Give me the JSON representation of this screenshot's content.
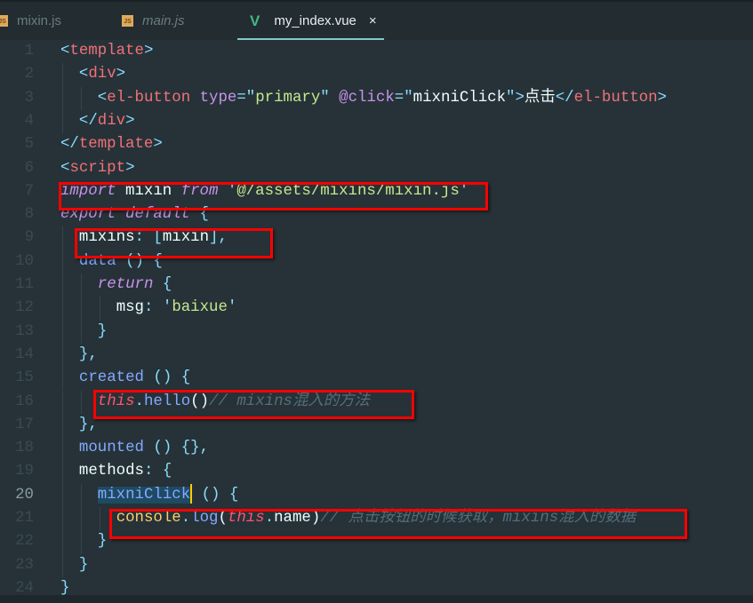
{
  "tabs": [
    {
      "label": "mixin.js",
      "icon": "js-file-icon",
      "active": false
    },
    {
      "label": "main.js",
      "icon": "js-file-icon",
      "active": false
    },
    {
      "label": "my_index.vue",
      "icon": "vue-file-icon",
      "active": true
    }
  ],
  "tab_close": "×",
  "js_icon_text": "JS",
  "vue_icon_text": "V",
  "current_line": 20,
  "lines": [
    {
      "n": "1",
      "indent": 0,
      "t": [
        [
          "<",
          "punct"
        ],
        [
          "template",
          "tag"
        ],
        [
          ">",
          "punct"
        ]
      ]
    },
    {
      "n": "2",
      "indent": 1,
      "t": [
        [
          "<",
          "punct"
        ],
        [
          "div",
          "tag"
        ],
        [
          ">",
          "punct"
        ]
      ]
    },
    {
      "n": "3",
      "indent": 2,
      "t": [
        [
          "<",
          "punct"
        ],
        [
          "el-button",
          "tag"
        ],
        [
          " ",
          "plain"
        ],
        [
          "type",
          "attr"
        ],
        [
          "=\"",
          "punct"
        ],
        [
          "primary",
          "str"
        ],
        [
          "\"",
          "punct"
        ],
        [
          " ",
          "plain"
        ],
        [
          "@click",
          "attr"
        ],
        [
          "=\"",
          "punct"
        ],
        [
          "mixniClick",
          "plain"
        ],
        [
          "\"",
          "punct"
        ],
        [
          ">",
          "punct"
        ],
        [
          "点击",
          "plain"
        ],
        [
          "</",
          "punct"
        ],
        [
          "el-button",
          "tag"
        ],
        [
          ">",
          "punct"
        ]
      ]
    },
    {
      "n": "4",
      "indent": 1,
      "t": [
        [
          "</",
          "punct"
        ],
        [
          "div",
          "tag"
        ],
        [
          ">",
          "punct"
        ]
      ]
    },
    {
      "n": "5",
      "indent": 0,
      "t": [
        [
          "</",
          "punct"
        ],
        [
          "template",
          "tag"
        ],
        [
          ">",
          "punct"
        ]
      ]
    },
    {
      "n": "6",
      "indent": 0,
      "t": [
        [
          "<",
          "punct"
        ],
        [
          "script",
          "tag"
        ],
        [
          ">",
          "punct"
        ]
      ]
    },
    {
      "n": "7",
      "indent": 0,
      "t": [
        [
          "import",
          "kw"
        ],
        [
          " mixin ",
          "plain"
        ],
        [
          "from",
          "kw"
        ],
        [
          " ",
          "plain"
        ],
        [
          "'",
          "punct"
        ],
        [
          "@/assets/mixins/mixin.js",
          "str"
        ],
        [
          "'",
          "punct"
        ]
      ]
    },
    {
      "n": "8",
      "indent": 0,
      "t": [
        [
          "export",
          "kw"
        ],
        [
          " ",
          "plain"
        ],
        [
          "default",
          "kw"
        ],
        [
          " {",
          "punct"
        ]
      ]
    },
    {
      "n": "9",
      "indent": 1,
      "t": [
        [
          "mixins",
          "plain"
        ],
        [
          ": [",
          "punct"
        ],
        [
          "mixin",
          "plain"
        ],
        [
          "],",
          "punct"
        ]
      ]
    },
    {
      "n": "10",
      "indent": 1,
      "t": [
        [
          "data",
          "fn"
        ],
        [
          " () {",
          "punct"
        ]
      ]
    },
    {
      "n": "11",
      "indent": 2,
      "t": [
        [
          "return",
          "kw"
        ],
        [
          " {",
          "punct"
        ]
      ]
    },
    {
      "n": "12",
      "indent": 3,
      "t": [
        [
          "msg",
          "plain"
        ],
        [
          ": ",
          "punct"
        ],
        [
          "'",
          "punct"
        ],
        [
          "baixue",
          "str"
        ],
        [
          "'",
          "punct"
        ]
      ]
    },
    {
      "n": "13",
      "indent": 2,
      "t": [
        [
          "}",
          "punct"
        ]
      ]
    },
    {
      "n": "14",
      "indent": 1,
      "t": [
        [
          "},",
          "punct"
        ]
      ]
    },
    {
      "n": "15",
      "indent": 1,
      "t": [
        [
          "created",
          "fn"
        ],
        [
          " () {",
          "punct"
        ]
      ]
    },
    {
      "n": "16",
      "indent": 2,
      "t": [
        [
          "this",
          "this"
        ],
        [
          ".",
          "punct"
        ],
        [
          "hello",
          "fn"
        ],
        [
          "()",
          "plain"
        ],
        [
          "// mixins混入的方法",
          "cmt"
        ]
      ]
    },
    {
      "n": "17",
      "indent": 1,
      "t": [
        [
          "},",
          "punct"
        ]
      ]
    },
    {
      "n": "18",
      "indent": 1,
      "t": [
        [
          "mounted",
          "fn"
        ],
        [
          " () {},",
          "punct"
        ]
      ]
    },
    {
      "n": "19",
      "indent": 1,
      "t": [
        [
          "methods",
          "plain"
        ],
        [
          ": {",
          "punct"
        ]
      ]
    },
    {
      "n": "20",
      "indent": 2,
      "t": [
        [
          "mixniClick",
          "sel"
        ],
        [
          "|",
          "cursor"
        ],
        [
          " () {",
          "punct"
        ]
      ]
    },
    {
      "n": "21",
      "indent": 3,
      "t": [
        [
          "console",
          "cls"
        ],
        [
          ".",
          "punct"
        ],
        [
          "log",
          "fn"
        ],
        [
          "(",
          "plain"
        ],
        [
          "this",
          "this"
        ],
        [
          ".",
          "punct"
        ],
        [
          "name",
          "plain"
        ],
        [
          ")",
          "plain"
        ],
        [
          "// 点击按钮的时候获取，mixins混入的数据",
          "cmt"
        ]
      ]
    },
    {
      "n": "22",
      "indent": 2,
      "t": [
        [
          "}",
          "punct"
        ]
      ]
    },
    {
      "n": "23",
      "indent": 1,
      "t": [
        [
          "}",
          "punct"
        ]
      ]
    },
    {
      "n": "24",
      "indent": 0,
      "t": [
        [
          "}",
          "punct"
        ]
      ]
    }
  ],
  "highlight_color": "#ff0000"
}
